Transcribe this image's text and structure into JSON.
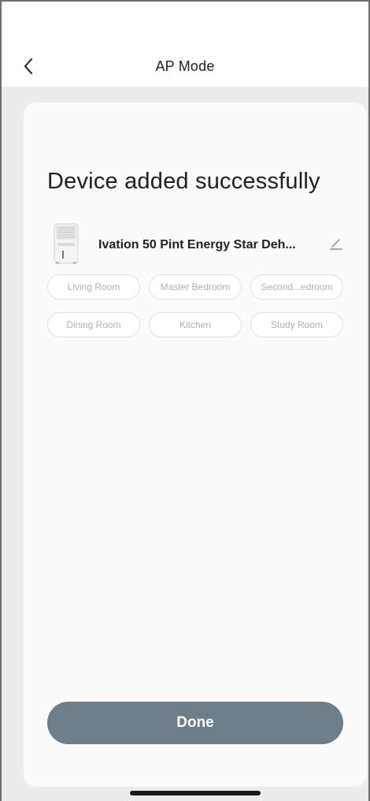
{
  "header": {
    "title": "AP Mode",
    "back_icon": "chevron-left-icon"
  },
  "main": {
    "success_title": "Device added successfully",
    "device": {
      "name": "Ivation 50 Pint Energy Star Deh...",
      "image_icon": "dehumidifier-icon",
      "edit_icon": "pencil-icon"
    },
    "rooms": [
      {
        "label": "Living Room"
      },
      {
        "label": "Master Bedroom"
      },
      {
        "label": "Second...edroom"
      },
      {
        "label": "Dining Room"
      },
      {
        "label": "Kitchen"
      },
      {
        "label": "Study Room"
      }
    ],
    "done_label": "Done"
  },
  "colors": {
    "done_button": "#6d7d8a",
    "background": "#ececec",
    "card": "#fbfbfb",
    "chip_text": "#b0b0b0",
    "chip_border": "#dddddd"
  }
}
